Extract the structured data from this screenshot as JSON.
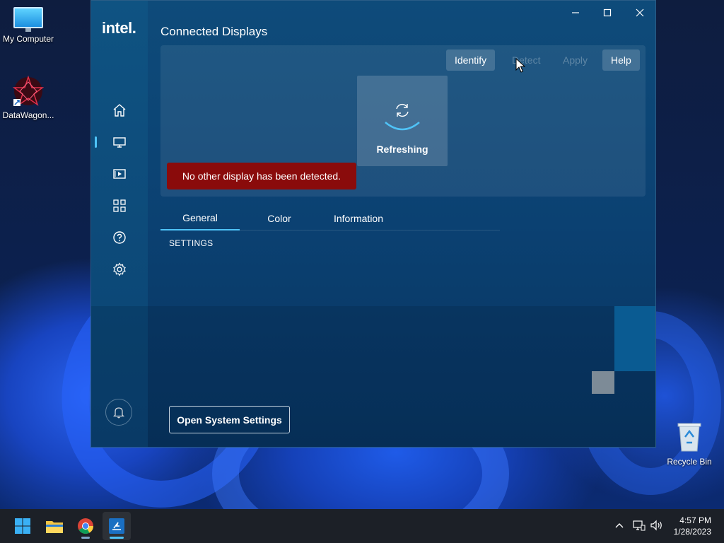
{
  "desktop": {
    "icons": [
      {
        "label": "My Computer"
      },
      {
        "label": "DataWagon..."
      },
      {
        "label": "Recycle Bin"
      }
    ]
  },
  "window": {
    "logo": "intel.",
    "title": "Connected Displays",
    "controls": {
      "minimize": "—",
      "maximize": "☐",
      "close": "✕"
    },
    "toolbar": {
      "identify": "Identify",
      "detect": "Detect",
      "apply": "Apply",
      "help": "Help"
    },
    "refresh_card": {
      "label": "Refreshing"
    },
    "alert": "No other display has been detected.",
    "tabs": [
      {
        "label": "General",
        "active": true
      },
      {
        "label": "Color",
        "active": false
      },
      {
        "label": "Information",
        "active": false
      }
    ],
    "settings_heading": "SETTINGS",
    "open_system_settings": "Open System Settings",
    "nav": [
      "home-icon",
      "display-icon",
      "media-icon",
      "apps-grid-icon",
      "help-icon",
      "gear-icon"
    ],
    "accent_color": "#4fc3f7",
    "alert_color": "#8a0b0b"
  },
  "taskbar": {
    "apps": [
      "start-icon",
      "file-explorer-icon",
      "chrome-icon",
      "intel-graphics-icon"
    ],
    "clock": {
      "time": "4:57 PM",
      "date": "1/28/2023"
    }
  }
}
